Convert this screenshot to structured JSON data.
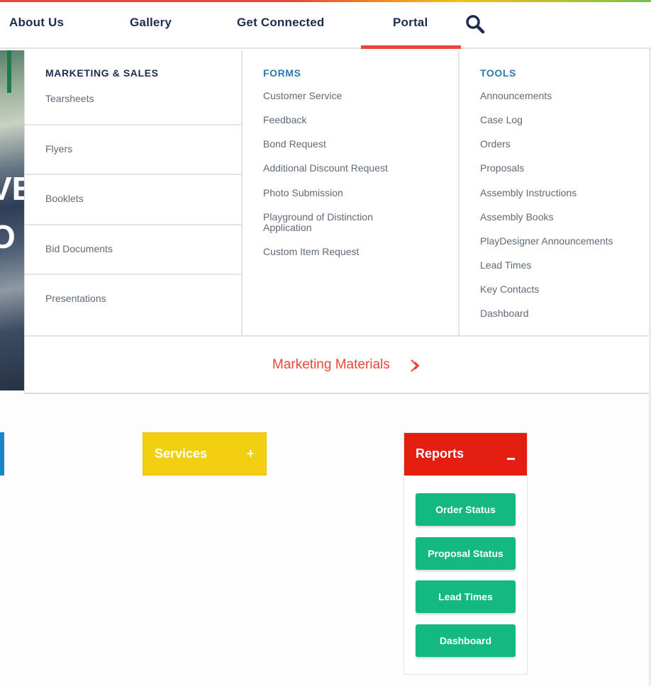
{
  "nav": {
    "items": [
      {
        "label": "About Us"
      },
      {
        "label": "Gallery"
      },
      {
        "label": "Get Connected"
      },
      {
        "label": "Portal"
      }
    ],
    "active": "Portal",
    "search_icon": "search-icon",
    "accent_color": "#e8473a",
    "text_color": "#1b2d4f"
  },
  "mega_menu": {
    "marketing": {
      "heading": "MARKETING & SALES",
      "items": [
        "Tearsheets",
        "Flyers",
        "Booklets",
        "Bid Documents",
        "Presentations"
      ]
    },
    "forms": {
      "heading": "FORMS",
      "items": [
        "Customer Service",
        "Feedback",
        "Bond Request",
        "Additional Discount Request",
        "Photo Submission",
        "Playground of Distinction Application",
        "Custom Item Request"
      ]
    },
    "tools": {
      "heading": "TOOLS",
      "items": [
        "Announcements",
        "Case Log",
        "Orders",
        "Proposals",
        "Assembly Instructions",
        "Assembly Books",
        "PlayDesigner Announcements",
        "Lead Times",
        "Key Contacts",
        "Dashboard"
      ]
    },
    "footer_link": {
      "label": "Marketing Materials",
      "icon": "chevron-double-right-icon"
    }
  },
  "hero": {
    "partial_text": [
      "VE",
      "O"
    ]
  },
  "panels": {
    "services": {
      "label": "Services",
      "toggle": "+",
      "color": "#f3cf12"
    },
    "reports": {
      "label": "Reports",
      "toggle": "minus",
      "color": "#e51e12",
      "buttons": [
        "Order Status",
        "Proposal Status",
        "Lead Times",
        "Dashboard"
      ],
      "button_color": "#13b980"
    }
  }
}
